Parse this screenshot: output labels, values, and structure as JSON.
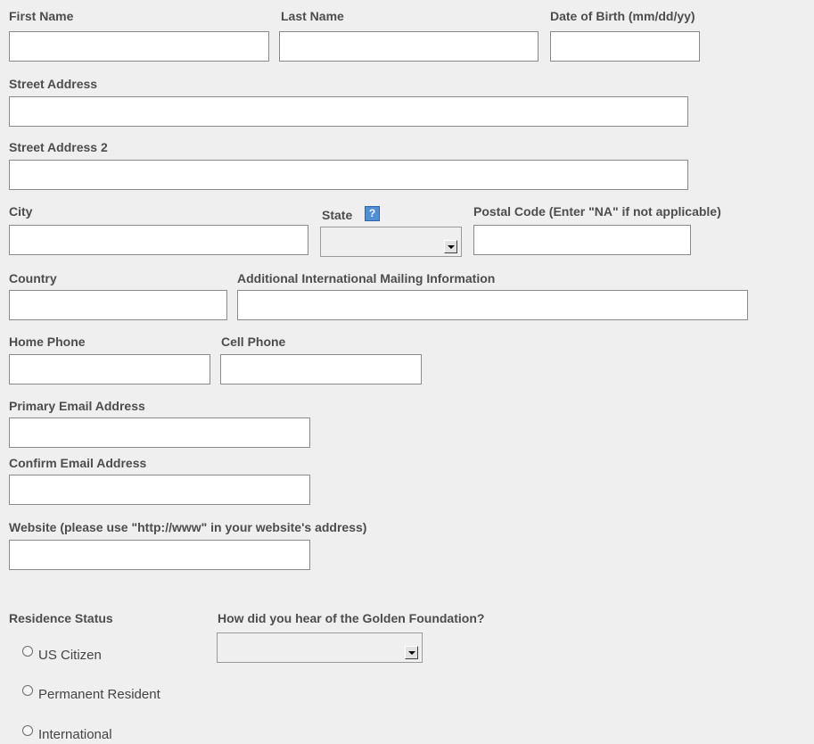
{
  "fields": {
    "first_name": {
      "label": "First Name",
      "value": ""
    },
    "last_name": {
      "label": "Last Name",
      "value": ""
    },
    "dob": {
      "label": "Date of Birth (mm/dd/yy)",
      "value": ""
    },
    "street": {
      "label": "Street Address",
      "value": ""
    },
    "street2": {
      "label": "Street Address 2",
      "value": ""
    },
    "city": {
      "label": "City",
      "value": ""
    },
    "state": {
      "label": "State",
      "help": "?",
      "value": ""
    },
    "postal": {
      "label": "Postal Code (Enter \"NA\" if not applicable)",
      "value": ""
    },
    "country": {
      "label": "Country",
      "value": ""
    },
    "intl": {
      "label": "Additional International Mailing Information",
      "value": ""
    },
    "home_phone": {
      "label": "Home Phone",
      "value": ""
    },
    "cell_phone": {
      "label": "Cell Phone",
      "value": ""
    },
    "email": {
      "label": "Primary Email Address",
      "value": ""
    },
    "email_confirm": {
      "label": "Confirm Email Address",
      "value": ""
    },
    "website": {
      "label": "Website (please use \"http://www\" in your website's address)",
      "value": ""
    }
  },
  "residence": {
    "label": "Residence Status",
    "options": [
      "US Citizen",
      "Permanent Resident",
      "International"
    ]
  },
  "referral": {
    "label": "How did you hear of the Golden Foundation?",
    "value": ""
  }
}
